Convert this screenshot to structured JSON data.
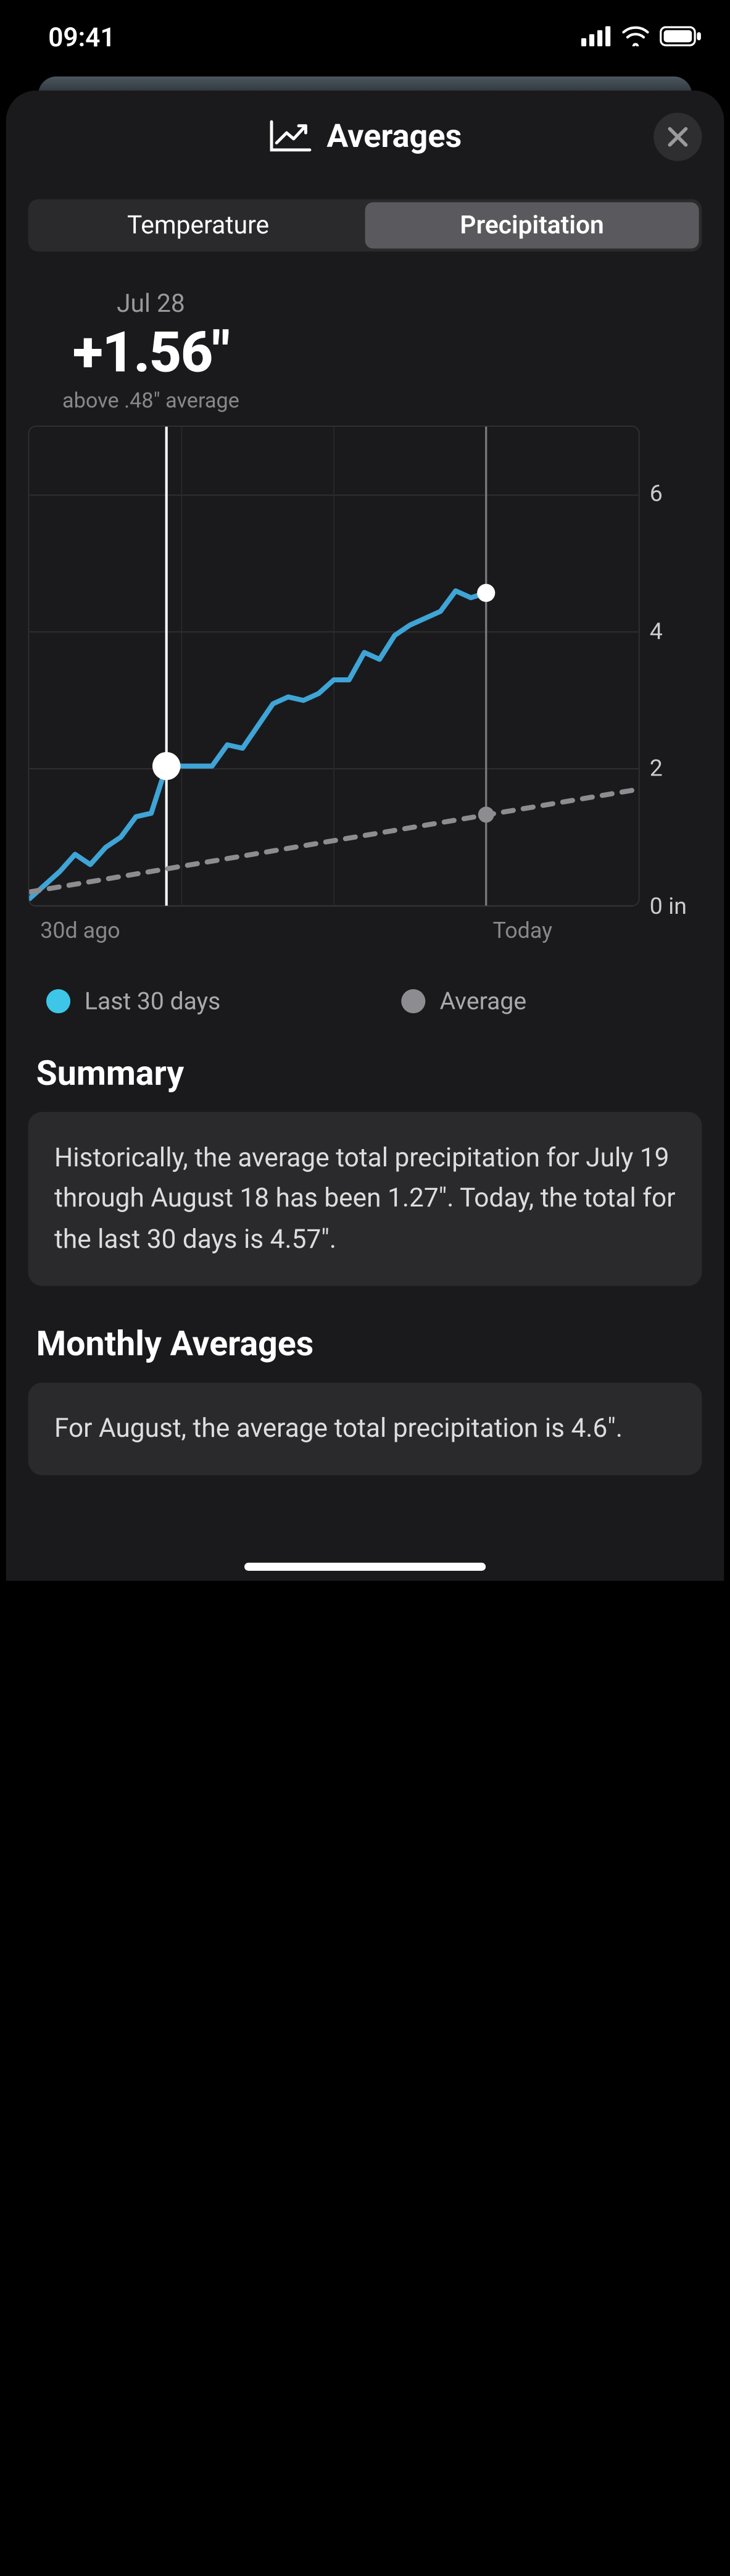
{
  "status_bar": {
    "time": "09:41"
  },
  "sheet": {
    "title": "Averages",
    "tabs": {
      "temperature": "Temperature",
      "precipitation": "Precipitation",
      "active": "precipitation"
    }
  },
  "readout": {
    "date": "Jul 28",
    "value": "+1.56\"",
    "subtitle": "above .48\" average"
  },
  "chart_data": {
    "type": "line",
    "title": "",
    "xlabel": "",
    "ylabel": "in",
    "ylim": [
      0,
      7
    ],
    "y_ticks": [
      0,
      2,
      4,
      6
    ],
    "x_axis_labels": {
      "start": "30d ago",
      "today": "Today"
    },
    "x_start": 0,
    "x_today": 30,
    "x_end": 40,
    "x_highlight": 9,
    "series": [
      {
        "name": "Last 30 days",
        "color": "#3fa4d6",
        "style": "solid",
        "points": [
          {
            "x": 0,
            "y": 0.1
          },
          {
            "x": 2,
            "y": 0.5
          },
          {
            "x": 3,
            "y": 0.75
          },
          {
            "x": 4,
            "y": 0.6
          },
          {
            "x": 5,
            "y": 0.85
          },
          {
            "x": 6,
            "y": 1.0
          },
          {
            "x": 7,
            "y": 1.3
          },
          {
            "x": 8,
            "y": 1.35
          },
          {
            "x": 9,
            "y": 2.04
          },
          {
            "x": 12,
            "y": 2.04
          },
          {
            "x": 13,
            "y": 2.35
          },
          {
            "x": 14,
            "y": 2.3
          },
          {
            "x": 16,
            "y": 2.95
          },
          {
            "x": 17,
            "y": 3.05
          },
          {
            "x": 18,
            "y": 3.0
          },
          {
            "x": 19,
            "y": 3.1
          },
          {
            "x": 20,
            "y": 3.3
          },
          {
            "x": 21,
            "y": 3.3
          },
          {
            "x": 22,
            "y": 3.7
          },
          {
            "x": 23,
            "y": 3.6
          },
          {
            "x": 24,
            "y": 3.95
          },
          {
            "x": 25,
            "y": 4.1
          },
          {
            "x": 27,
            "y": 4.3
          },
          {
            "x": 28,
            "y": 4.6
          },
          {
            "x": 29,
            "y": 4.5
          },
          {
            "x": 30,
            "y": 4.57
          }
        ]
      },
      {
        "name": "Average",
        "color": "#8d8d91",
        "style": "dashed",
        "points": [
          {
            "x": 0,
            "y": 0.2
          },
          {
            "x": 40,
            "y": 1.7
          }
        ],
        "marker_at_x": 30,
        "marker_y": 1.33
      }
    ],
    "highlight_marker": {
      "x": 9,
      "y": 2.04
    }
  },
  "legend": {
    "actual": {
      "label": "Last 30 days",
      "color": "#3dc6e8"
    },
    "average": {
      "label": "Average",
      "color": "#8d8d91"
    }
  },
  "summary": {
    "heading": "Summary",
    "text": "Historically, the average total precipitation for July 19 through August 18 has been 1.27\". Today, the total for the last 30 days is 4.57\"."
  },
  "monthly": {
    "heading": "Monthly Averages",
    "text": "For August, the average total precipitation is 4.6\"."
  }
}
